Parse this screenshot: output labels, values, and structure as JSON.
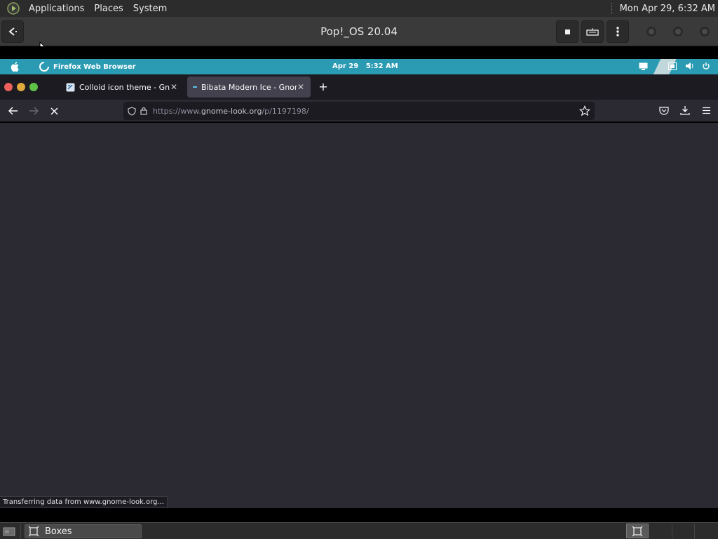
{
  "host_panel": {
    "menus": [
      "Applications",
      "Places",
      "System"
    ],
    "clock": "Mon Apr 29,  6:32 AM"
  },
  "boxes": {
    "title": "Pop!_OS 20.04",
    "taskbar_label": "Boxes"
  },
  "guest_bar": {
    "app_name": "Firefox Web Browser",
    "date": "Apr 29",
    "time": "5:32 AM",
    "color": "#2a9bb3"
  },
  "browser": {
    "tabs": [
      {
        "title": "Colloid icon theme - Gnome-look.org",
        "active": false
      },
      {
        "title": "Bibata Modern Ice - Gnome-look.org",
        "active": true
      }
    ],
    "url": {
      "prefix": "https://www.",
      "host": "gnome-look.org",
      "path": "/p/1197198/"
    },
    "status": "Transferring data from www.gnome-look.org..."
  },
  "icons": {
    "back": "arrow-left-icon",
    "forward": "arrow-right-icon",
    "stop": "close-icon",
    "shield": "shield-icon",
    "lock": "lock-icon",
    "bookmark": "star-icon",
    "pocket": "pocket-icon",
    "downloads": "download-icon",
    "menu": "hamburger-menu-icon"
  }
}
